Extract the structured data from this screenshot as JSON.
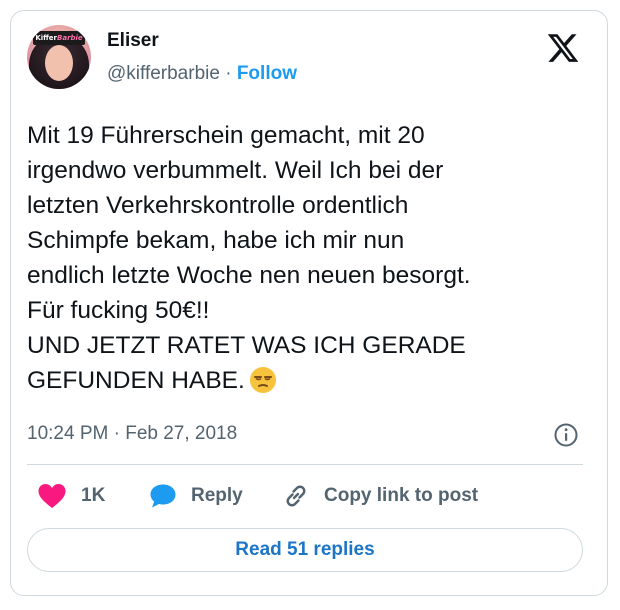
{
  "author": {
    "display_name": "Eliser",
    "handle": "@kifferbarbie",
    "separator": "·",
    "follow_label": "Follow",
    "avatar_cap_text": "Kiffer",
    "avatar_cap_brand": "Barbie"
  },
  "tweet": {
    "lines": [
      "Mit 19 Führerschein gemacht, mit 20",
      "irgendwo verbummelt. Weil Ich bei der",
      "letzten Verkehrskontrolle ordentlich",
      "Schimpfe bekam, habe ich mir nun",
      "endlich letzte Woche nen neuen besorgt.",
      "Für fucking 50€!!",
      "UND JETZT RATET WAS ICH GERADE",
      "GEFUNDEN HABE."
    ],
    "trailing_emoji": "unamused-face-emoji",
    "timestamp": "10:24 PM · Feb 27, 2018"
  },
  "actions": {
    "like_count": "1K",
    "reply_label": "Reply",
    "copy_link_label": "Copy link to post"
  },
  "read_replies_label": "Read 51 replies",
  "icons": {
    "platform": "x-logo-icon",
    "info": "info-icon",
    "like": "heart-icon",
    "reply": "speech-bubble-icon",
    "copy": "link-icon"
  },
  "colors": {
    "accent": "#1d9bf0",
    "like": "#f91880",
    "text": "#0f1419",
    "muted": "#536471",
    "border": "#cfd9de"
  }
}
